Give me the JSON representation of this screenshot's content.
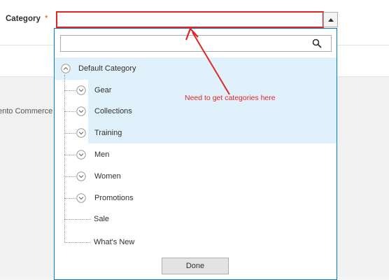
{
  "form": {
    "category_label": "Category",
    "required_marker": "*",
    "select_value": ""
  },
  "background_text": "ento Commerce",
  "dropdown": {
    "search_value": "",
    "search_icon": "search-icon",
    "tree": {
      "root": "Default Category",
      "items": [
        "Gear",
        "Collections",
        "Training",
        "Men",
        "Women",
        "Promotions",
        "Sale",
        "What's New"
      ]
    },
    "done_label": "Done"
  },
  "annotation": {
    "text": "Need to get categories here",
    "color": "#e22626"
  },
  "colors": {
    "highlight": "#e1f1fb",
    "dropdown_border": "#007bdb",
    "required": "#eb5202"
  }
}
